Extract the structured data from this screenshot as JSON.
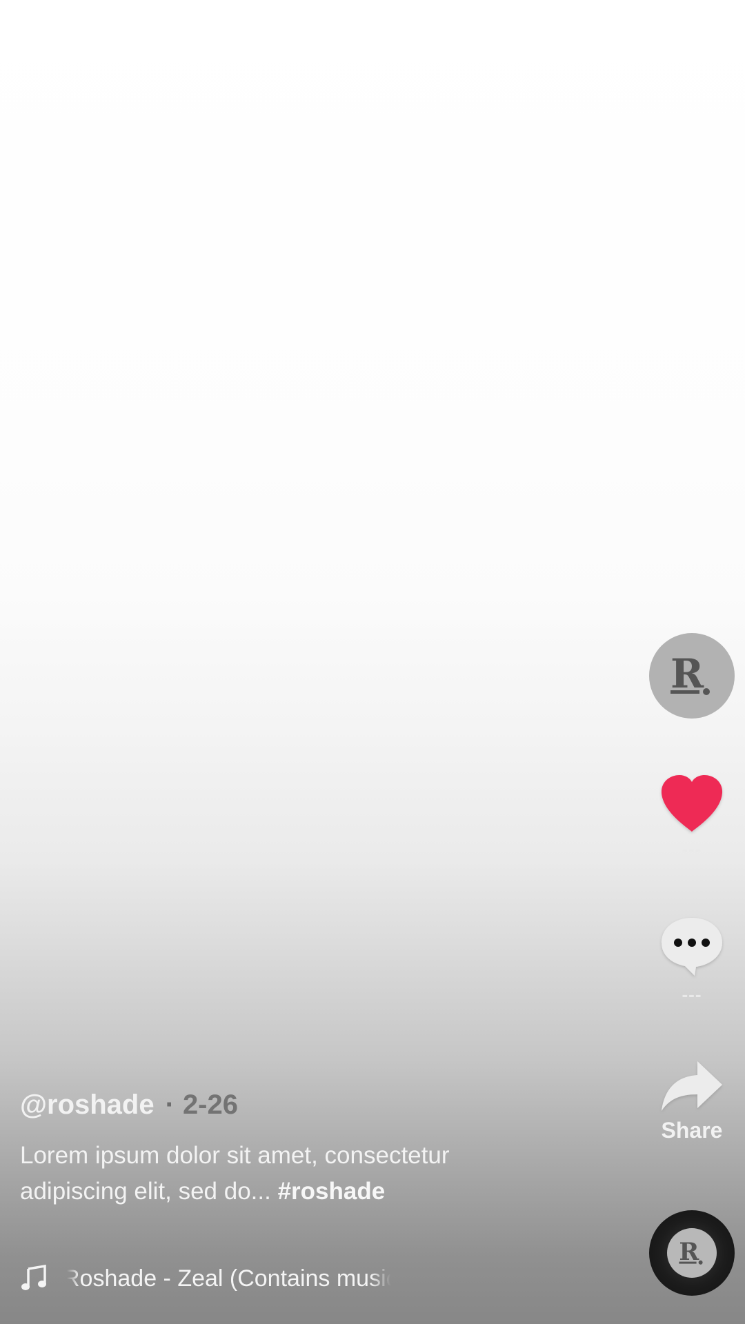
{
  "author": {
    "username": "@roshade",
    "date": "2-26",
    "avatar_icon": "roshade-logo-icon"
  },
  "caption": {
    "text": "Lorem ipsum dolor sit amet, consectetur adipiscing elit, sed do... ",
    "hashtag": "#roshade"
  },
  "actions": {
    "like": {
      "icon": "heart-icon",
      "count": "---",
      "color": "#ee2a55"
    },
    "comment": {
      "icon": "comment-bubble-icon",
      "count": "---"
    },
    "share": {
      "icon": "share-arrow-icon",
      "label": "Share"
    }
  },
  "music": {
    "icon": "music-note-icon",
    "title": "Roshade - Zeal (Contains music",
    "disc_icon": "roshade-logo-icon"
  },
  "separator": "·"
}
